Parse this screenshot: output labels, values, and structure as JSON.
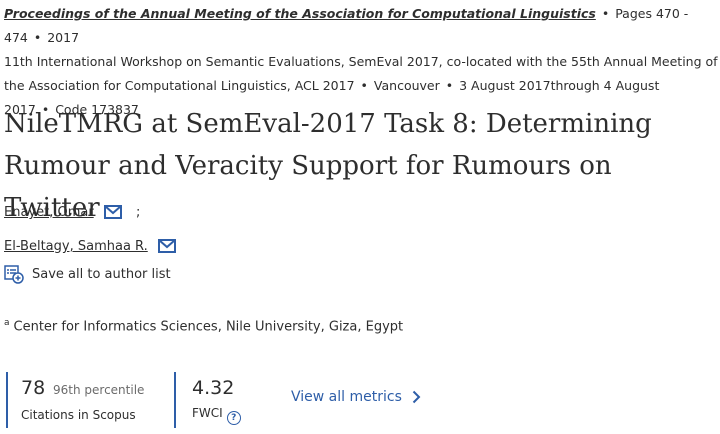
{
  "source": {
    "journal": "Proceedings of the Annual Meeting of the Association for Computational Linguistics",
    "pages": "Pages 470 - 474",
    "year": "2017",
    "conference": "11th International Workshop on Semantic Evaluations, SemEval 2017, co-located with the 55th Annual Meeting of the Association for Computational Linguistics, ACL 2017",
    "location": "Vancouver",
    "dates": "3 August 2017through 4 August 2017",
    "code": "Code 173837"
  },
  "title": "NileTMRG at SemEval-2017 Task 8: Determining Rumour and Veracity Support for Rumours on Twitter",
  "authors": [
    {
      "name": "Enayet, Omar",
      "separator": ";"
    },
    {
      "name": "El-Beltagy, Samhaa R.",
      "separator": ""
    }
  ],
  "save_label": "Save all to author list",
  "affiliation": {
    "marker": "a",
    "text": "Center for Informatics Sciences, Nile University, Giza, Egypt"
  },
  "metrics": {
    "citations": {
      "value": "78",
      "percentile": "96th percentile",
      "label": "Citations in Scopus"
    },
    "fwci": {
      "value": "4.32",
      "label": "FWCI"
    },
    "view_all": "View all metrics"
  },
  "colors": {
    "link_blue": "#2e5ea8",
    "text": "#2e2e2e",
    "muted": "#6b6b6b"
  }
}
